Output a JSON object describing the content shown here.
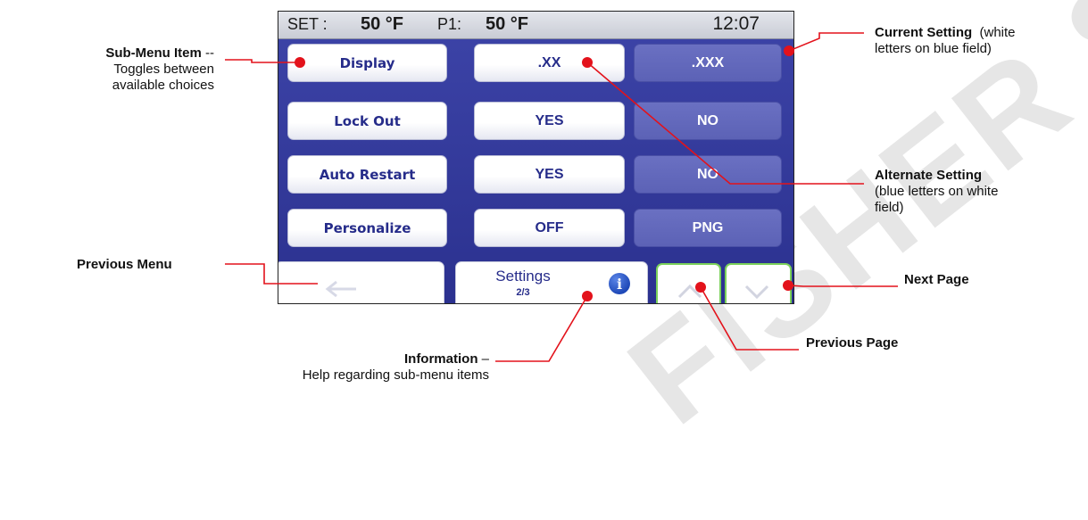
{
  "watermark": "FISHER S",
  "status": {
    "set_label": "SET :",
    "set_value": "50 °F",
    "p1_label": "P1:",
    "p1_value": "50 °F",
    "time": "12:07"
  },
  "rows": [
    {
      "item": "Display",
      "alternate": ".XX",
      "current": ".XXX"
    },
    {
      "item": "Lock Out",
      "alternate": "YES",
      "current": "NO"
    },
    {
      "item": "Auto Restart",
      "alternate": "YES",
      "current": "NO"
    },
    {
      "item": "Personalize",
      "alternate": "OFF",
      "current": "PNG"
    }
  ],
  "bottom": {
    "menu_title": "Settings",
    "page_indicator": "2/3",
    "info_icon": "i"
  },
  "annotations": {
    "submenu": {
      "title": "Sub-Menu Item",
      "suffix": " --",
      "line2": "Toggles between",
      "line3": "available choices"
    },
    "previous_menu": {
      "title": "Previous Menu"
    },
    "current_setting": {
      "title": "Current Setting",
      "note": "  (white",
      "line2": "letters on blue field)"
    },
    "alternate_setting": {
      "title": "Alternate Setting",
      "line2": "(blue letters on white",
      "line3": "field)"
    },
    "next_page": {
      "title": "Next Page"
    },
    "previous_page": {
      "title": "Previous Page"
    },
    "information": {
      "title": "Information",
      "suffix": " –",
      "line2": "Help regarding sub-menu items"
    }
  },
  "colors": {
    "screen_blue": "#2b318f",
    "current_field": "#5c62b6",
    "alt_text": "#262c8a",
    "leader_red": "#e3121b",
    "page_btn_border": "#7bd15a"
  }
}
